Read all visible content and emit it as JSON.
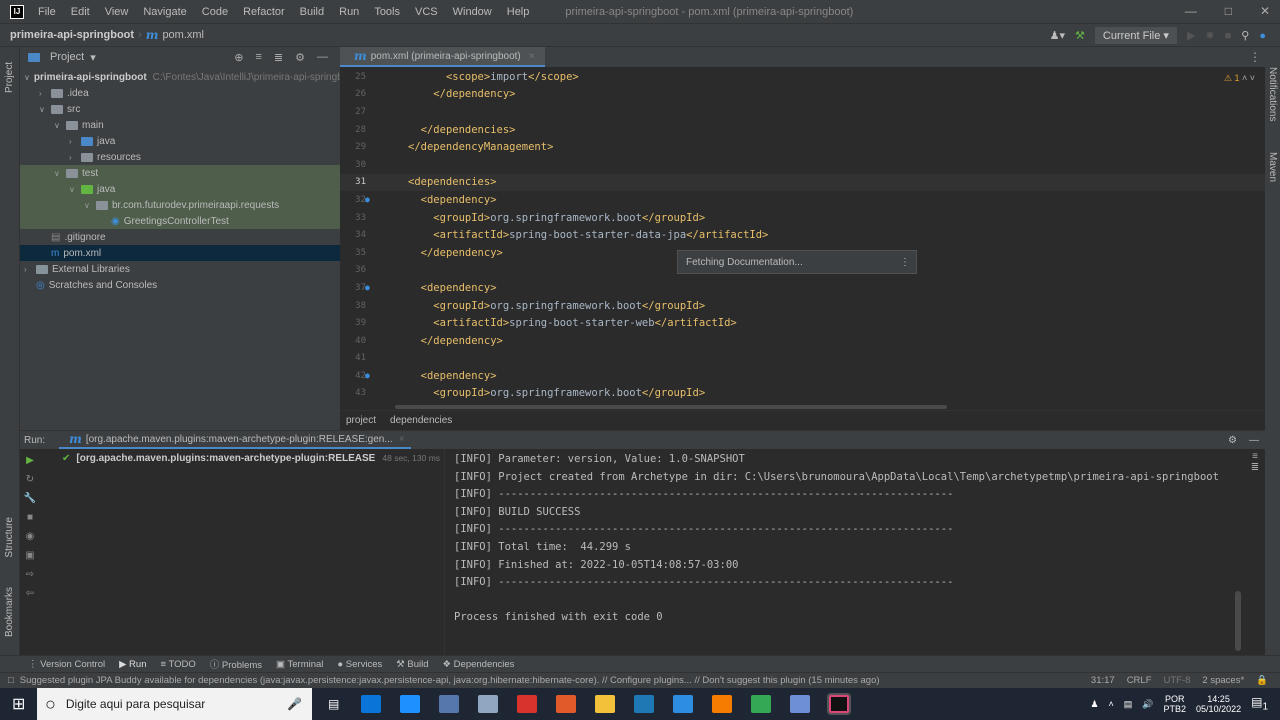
{
  "menubar": {
    "items": [
      "File",
      "Edit",
      "View",
      "Navigate",
      "Code",
      "Refactor",
      "Build",
      "Run",
      "Tools",
      "VCS",
      "Window",
      "Help"
    ],
    "title": "primeira-api-springboot - pom.xml (primeira-api-springboot)"
  },
  "breadcrumb": {
    "project": "primeira-api-springboot",
    "file": "pom.xml"
  },
  "toolbar_right": {
    "config": "Current File"
  },
  "side": {
    "project": "Project",
    "structure": "Structure",
    "bookmarks": "Bookmarks",
    "notifications": "Notifications",
    "maven": "Maven"
  },
  "project": {
    "title": "Project",
    "tree": [
      {
        "label": "primeira-api-springboot",
        "hint": "C:\\Fontes\\Java\\IntelliJ\\primeira-api-springboot",
        "depth": 0,
        "arrow": "v",
        "icon": "src"
      },
      {
        "label": ".idea",
        "depth": 1,
        "arrow": ">",
        "icon": "folder"
      },
      {
        "label": "src",
        "depth": 1,
        "arrow": "v",
        "icon": "folder"
      },
      {
        "label": "main",
        "depth": 2,
        "arrow": "v",
        "icon": "folder"
      },
      {
        "label": "java",
        "depth": 3,
        "arrow": ">",
        "icon": "blue"
      },
      {
        "label": "resources",
        "depth": 3,
        "arrow": ">",
        "icon": "folder"
      },
      {
        "label": "test",
        "depth": 2,
        "arrow": "v",
        "icon": "folder"
      },
      {
        "label": "java",
        "depth": 3,
        "arrow": "v",
        "icon": "green"
      },
      {
        "label": "br.com.futurodev.primeiraapi.requests",
        "depth": 4,
        "arrow": "v",
        "icon": "folder"
      },
      {
        "label": "GreetingsControllerTest",
        "depth": 5,
        "arrow": "",
        "icon": "class"
      },
      {
        "label": ".gitignore",
        "depth": 1,
        "arrow": "",
        "icon": "file"
      },
      {
        "label": "pom.xml",
        "depth": 1,
        "arrow": "",
        "icon": "maven"
      },
      {
        "label": "External Libraries",
        "depth": 0,
        "arrow": ">",
        "icon": "lib"
      },
      {
        "label": "Scratches and Consoles",
        "depth": 0,
        "arrow": "",
        "icon": "scratch"
      }
    ]
  },
  "editor": {
    "tab": "pom.xml (primeira-api-springboot)",
    "warnings": "1",
    "lines": [
      {
        "n": "25",
        "indent": 3,
        "parts": [
          [
            "tag",
            "<scope>"
          ],
          [
            "txt",
            "import"
          ],
          [
            "tag",
            "</scope>"
          ]
        ]
      },
      {
        "n": "26",
        "indent": 2,
        "parts": [
          [
            "tag",
            "</dependency>"
          ]
        ]
      },
      {
        "n": "27",
        "indent": 0,
        "parts": []
      },
      {
        "n": "28",
        "indent": 1,
        "parts": [
          [
            "tag",
            "</dependencies>"
          ]
        ]
      },
      {
        "n": "29",
        "indent": 0,
        "parts": [
          [
            "tag",
            "</dependencyManagement>"
          ]
        ]
      },
      {
        "n": "30",
        "indent": 0,
        "parts": []
      },
      {
        "n": "31",
        "indent": 0,
        "parts": [
          [
            "tag",
            "<dependencies>"
          ]
        ]
      },
      {
        "n": "32",
        "indent": 1,
        "parts": [
          [
            "tag",
            "<dependency>"
          ]
        ]
      },
      {
        "n": "33",
        "indent": 2,
        "parts": [
          [
            "tag",
            "<groupId>"
          ],
          [
            "txt",
            "org.springframework.boot"
          ],
          [
            "tag",
            "</groupId>"
          ]
        ]
      },
      {
        "n": "34",
        "indent": 2,
        "parts": [
          [
            "tag",
            "<artifactId>"
          ],
          [
            "txt",
            "spring-boot-starter-data-jpa"
          ],
          [
            "tag",
            "</artifactId>"
          ]
        ]
      },
      {
        "n": "35",
        "indent": 1,
        "parts": [
          [
            "tag",
            "</dependency>"
          ]
        ]
      },
      {
        "n": "36",
        "indent": 0,
        "parts": []
      },
      {
        "n": "37",
        "indent": 1,
        "parts": [
          [
            "tag",
            "<dependency>"
          ]
        ]
      },
      {
        "n": "38",
        "indent": 2,
        "parts": [
          [
            "tag",
            "<groupId>"
          ],
          [
            "txt",
            "org.springframework.boot"
          ],
          [
            "tag",
            "</groupId>"
          ]
        ]
      },
      {
        "n": "39",
        "indent": 2,
        "parts": [
          [
            "tag",
            "<artifactId>"
          ],
          [
            "txt",
            "spring-boot-starter-web"
          ],
          [
            "tag",
            "</artifactId>"
          ]
        ]
      },
      {
        "n": "40",
        "indent": 1,
        "parts": [
          [
            "tag",
            "</dependency>"
          ]
        ]
      },
      {
        "n": "41",
        "indent": 0,
        "parts": []
      },
      {
        "n": "42",
        "indent": 1,
        "parts": [
          [
            "tag",
            "<dependency>"
          ]
        ]
      },
      {
        "n": "43",
        "indent": 2,
        "parts": [
          [
            "tag",
            "<groupId>"
          ],
          [
            "txt",
            "org.springframework.boot"
          ],
          [
            "tag",
            "</groupId>"
          ]
        ]
      }
    ],
    "popup": "Fetching Documentation...",
    "nav": [
      "project",
      "dependencies"
    ]
  },
  "run": {
    "label": "Run:",
    "tab": "[org.apache.maven.plugins:maven-archetype-plugin:RELEASE:gen...",
    "item": "[org.apache.maven.plugins:maven-archetype-plugin:RELEASE:genera",
    "time": "48 sec, 130 ms",
    "console": [
      "[INFO] Parameter: version, Value: 1.0-SNAPSHOT",
      "[INFO] Project created from Archetype in dir: C:\\Users\\brunomoura\\AppData\\Local\\Temp\\archetypetmp\\primeira-api-springboot",
      "[INFO] ------------------------------------------------------------------------",
      "[INFO] BUILD SUCCESS",
      "[INFO] ------------------------------------------------------------------------",
      "[INFO] Total time:  44.299 s",
      "[INFO] Finished at: 2022-10-05T14:08:57-03:00",
      "[INFO] ------------------------------------------------------------------------",
      "",
      "Process finished with exit code 0"
    ]
  },
  "tools": [
    "Version Control",
    "Run",
    "TODO",
    "Problems",
    "Terminal",
    "Services",
    "Build",
    "Dependencies"
  ],
  "status": {
    "message": "Suggested plugin JPA Buddy available for dependencies (java:javax.persistence:javax.persistence-api, java:org.hibernate:hibernate-core). // Configure plugins... // Don't suggest this plugin (15 minutes ago)",
    "pos": "31:17",
    "eol": "CRLF",
    "enc": "UTF-8",
    "indent": "2 spaces*"
  },
  "taskbar": {
    "search": "Digite aqui para pesquisar",
    "lang1": "POR",
    "lang2": "PTB2",
    "time": "14:25",
    "date": "05/10/2022",
    "notif": "1",
    "colors": [
      "#2b79d6",
      "#0a74d8",
      "#1e90ff",
      "#5577aa",
      "#8fa7c0",
      "#d9342b",
      "#e05a2a",
      "#f3c13a",
      "#1f77b4",
      "#2d8de0",
      "#f57c00",
      "#34a853",
      "#6d8fd6",
      "#000000"
    ]
  }
}
